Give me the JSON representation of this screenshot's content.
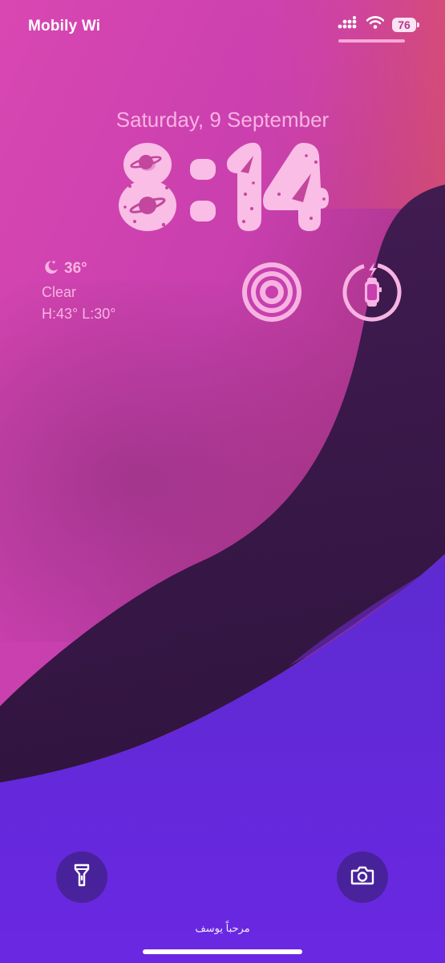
{
  "status_bar": {
    "carrier": "Mobily Wi",
    "battery_level": "76",
    "signal_icon": "cellular-signal-icon",
    "wifi_icon": "wifi-icon"
  },
  "lock_screen": {
    "date": "Saturday, 9 September",
    "time": "8:14",
    "clock_style": "pink bubble digits with planets and rockets"
  },
  "widgets": {
    "weather": {
      "icon": "moon-stars-icon",
      "temperature": "36°",
      "condition": "Clear",
      "high_low": "H:43° L:30°"
    },
    "focus_icon": "target-rings-icon",
    "watch_battery_icon": "watch-charging-icon"
  },
  "quick_actions": {
    "flashlight_icon": "flashlight-icon",
    "camera_icon": "camera-icon"
  },
  "footer": {
    "greeting": "مرحباً يوسف"
  },
  "colors": {
    "accent_pink": "#f7b3e2",
    "bg_top": "#d445ad",
    "bg_dark": "#34184a",
    "bg_purple": "#5a25d6"
  }
}
